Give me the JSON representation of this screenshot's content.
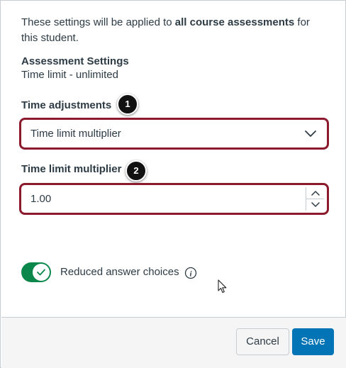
{
  "intro": {
    "prefix": "These settings will be applied to ",
    "bold": "all course assessments",
    "suffix": " for this student."
  },
  "assessment_settings": {
    "heading": "Assessment Settings",
    "value": "Time limit - unlimited"
  },
  "time_adjustments": {
    "label": "Time adjustments",
    "selected": "Time limit multiplier",
    "callout": "1"
  },
  "multiplier": {
    "label": "Time limit multiplier",
    "value": "1.00",
    "callout": "2"
  },
  "reduced_answers": {
    "label": "Reduced answer choices",
    "enabled": true
  },
  "footer": {
    "cancel_label": "Cancel",
    "save_label": "Save"
  },
  "colors": {
    "highlight": "#8b1a2c",
    "toggle_on": "#0b874b",
    "primary": "#0374b5",
    "text": "#2d3b45"
  },
  "icons": {
    "select": "chevron-down-icon",
    "stepper_up": "chevron-up-icon",
    "stepper_down": "chevron-down-icon",
    "toggle": "checkmark-icon",
    "info": "info-icon",
    "cursor": "mouse-pointer-icon"
  }
}
